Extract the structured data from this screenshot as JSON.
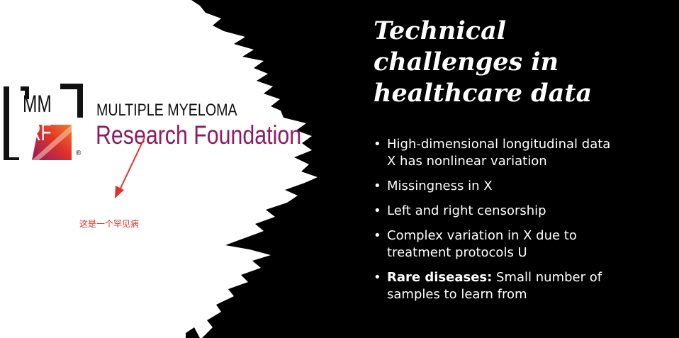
{
  "logo": {
    "letters_top": "MM",
    "letters_bottom": "RF",
    "name_line1": "MULTIPLE MYELOMA",
    "name_line2": "Research Foundation",
    "registered": "®",
    "brand_color": "#8e1b63"
  },
  "annotation": {
    "text": "这是一个罕见病",
    "color": "#e0322a"
  },
  "title": {
    "lines": [
      "Technical",
      "challenges in",
      "healthcare data"
    ]
  },
  "bullets": [
    {
      "lines": [
        "High-dimensional longitudinal data",
        "X has nonlinear variation"
      ]
    },
    {
      "lines": [
        "Missingness in X"
      ]
    },
    {
      "lines": [
        "Left and right censorship"
      ]
    },
    {
      "lines": [
        "Complex variation in X due to",
        "treatment protocols U"
      ]
    },
    {
      "bold": "Rare diseases:",
      "lines": [
        " Small number of",
        "samples to learn from"
      ]
    }
  ]
}
